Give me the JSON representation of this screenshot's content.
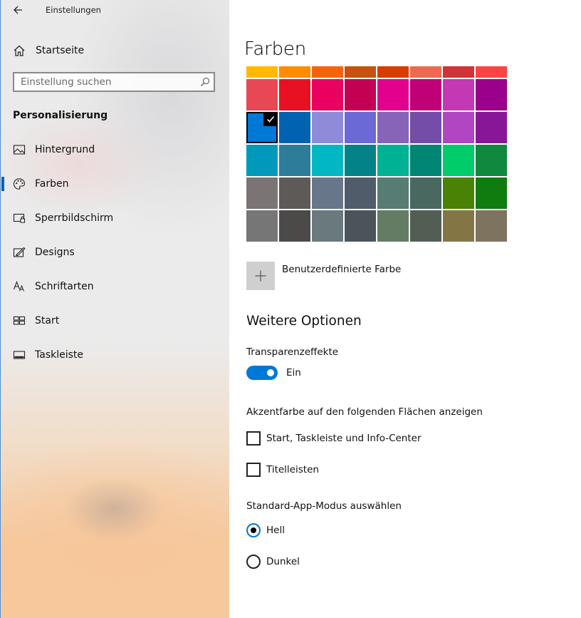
{
  "window": {
    "title": "Einstellungen"
  },
  "sidebar": {
    "home_label": "Startseite",
    "search_placeholder": "Einstellung suchen",
    "section_title": "Personalisierung",
    "items": [
      {
        "label": "Hintergrund",
        "icon": "picture-icon",
        "selected": false
      },
      {
        "label": "Farben",
        "icon": "palette-icon",
        "selected": true
      },
      {
        "label": "Sperrbildschirm",
        "icon": "lock-screen-icon",
        "selected": false
      },
      {
        "label": "Designs",
        "icon": "themes-icon",
        "selected": false
      },
      {
        "label": "Schriftarten",
        "icon": "fonts-icon",
        "selected": false
      },
      {
        "label": "Start",
        "icon": "start-icon",
        "selected": false
      },
      {
        "label": "Taskleiste",
        "icon": "taskbar-icon",
        "selected": false
      }
    ]
  },
  "main": {
    "title": "Farben",
    "palette": {
      "rows": [
        [
          "#FFB900",
          "#FF8C00",
          "#F7630C",
          "#CA5010",
          "#DA3B01",
          "#EF6950",
          "#D13438",
          "#FF4343"
        ],
        [
          "#E74856",
          "#E81123",
          "#EA005E",
          "#C30052",
          "#E3008C",
          "#BF0077",
          "#C239B3",
          "#9A0089"
        ],
        [
          "#0078D7",
          "#0063B1",
          "#8E8CD8",
          "#6B69D6",
          "#8764B8",
          "#744DA9",
          "#B146C2",
          "#881798"
        ],
        [
          "#0099BC",
          "#2D7D9A",
          "#00B7C3",
          "#038387",
          "#00B294",
          "#018574",
          "#00CC6A",
          "#10893E"
        ],
        [
          "#7A7574",
          "#5D5A58",
          "#68768A",
          "#515C6B",
          "#567C73",
          "#486860",
          "#498205",
          "#107C10"
        ],
        [
          "#767676",
          "#4C4A48",
          "#69797E",
          "#4A5459",
          "#647C64",
          "#525E54",
          "#847545",
          "#7E735F"
        ]
      ],
      "selected": {
        "row": 2,
        "col": 0
      }
    },
    "custom_color_label": "Benutzerdefinierte Farbe",
    "more_options_title": "Weitere Optionen",
    "transparency_label": "Transparenzeffekte",
    "transparency_state": "Ein",
    "transparency_on": true,
    "accent_surfaces_label": "Akzentfarbe auf den folgenden Flächen anzeigen",
    "checkbox_start_label": "Start, Taskleiste und Info-Center",
    "checkbox_start_checked": false,
    "checkbox_titlebars_label": "Titelleisten",
    "checkbox_titlebars_checked": false,
    "app_mode_label": "Standard-App-Modus auswählen",
    "radio_light_label": "Hell",
    "radio_dark_label": "Dunkel",
    "app_mode_selected": "Hell"
  },
  "colors": {
    "accent": "#0078D7",
    "toggle_on": "#0078D7",
    "nav_selection": "#0063B1"
  }
}
